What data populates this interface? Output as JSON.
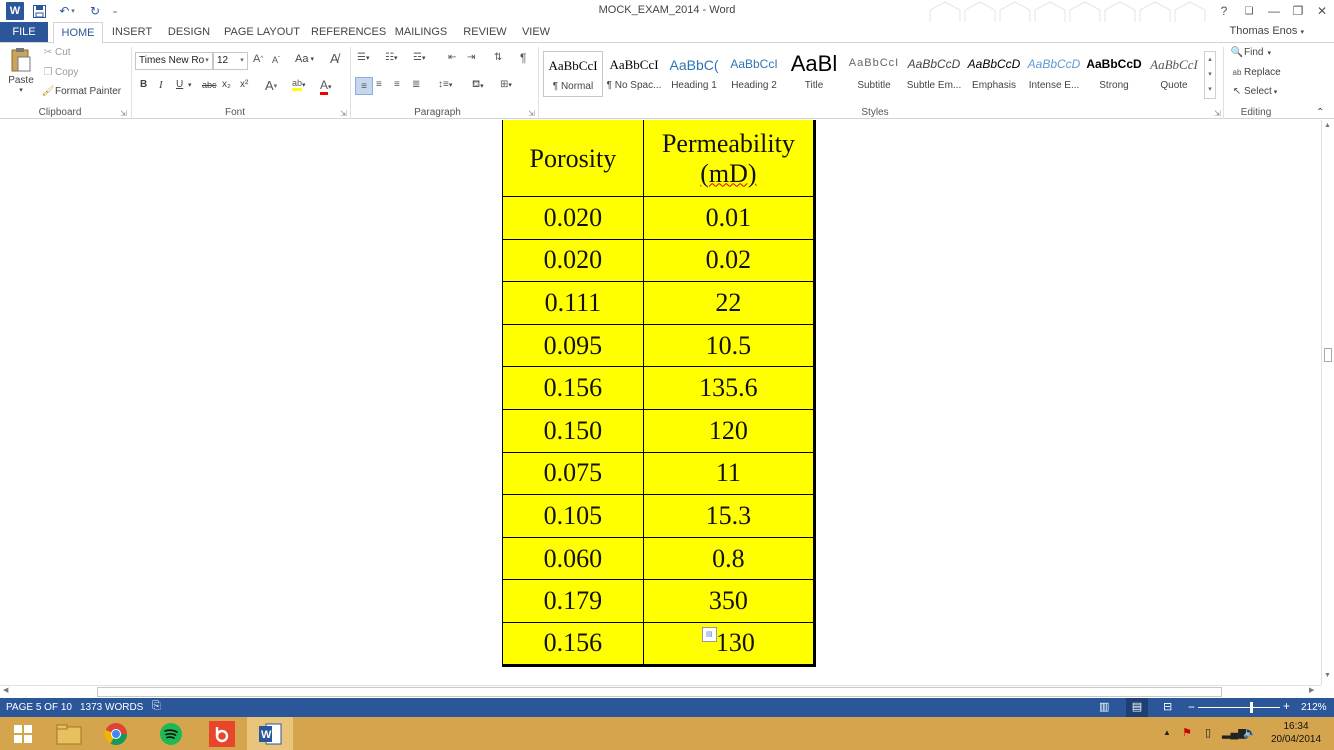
{
  "window": {
    "title": "MOCK_EXAM_2014 - Word",
    "user": "Thomas Enos",
    "help": "?",
    "minimize": "—",
    "restore": "❐",
    "close": "✕",
    "ribbon_toggle": "❏"
  },
  "tabs": [
    "FILE",
    "HOME",
    "INSERT",
    "DESIGN",
    "PAGE LAYOUT",
    "REFERENCES",
    "MAILINGS",
    "REVIEW",
    "VIEW"
  ],
  "clipboard": {
    "paste": "Paste",
    "cut": "Cut",
    "copy": "Copy",
    "format_painter": "Format Painter",
    "label": "Clipboard"
  },
  "font": {
    "name": "Times New Ro",
    "size": "12",
    "label": "Font",
    "change_case": "Aa",
    "bold": "B",
    "italic": "I",
    "underline": "U",
    "strike": "abc",
    "subscript": "x₂",
    "superscript": "x²"
  },
  "paragraph": {
    "label": "Paragraph"
  },
  "styles": {
    "label": "Styles",
    "items": [
      {
        "preview": "AaBbCcI",
        "name": "¶ Normal"
      },
      {
        "preview": "AaBbCcI",
        "name": "¶ No Spac..."
      },
      {
        "preview": "AaBbC(",
        "name": "Heading 1"
      },
      {
        "preview": "AaBbCcI",
        "name": "Heading 2"
      },
      {
        "preview": "AaBl",
        "name": "Title"
      },
      {
        "preview": "AaBbCcI",
        "name": "Subtitle"
      },
      {
        "preview": "AaBbCcD",
        "name": "Subtle Em..."
      },
      {
        "preview": "AaBbCcD",
        "name": "Emphasis"
      },
      {
        "preview": "AaBbCcD",
        "name": "Intense E..."
      },
      {
        "preview": "AaBbCcD",
        "name": "Strong"
      },
      {
        "preview": "AaBbCcI",
        "name": "Quote"
      }
    ]
  },
  "editing": {
    "find": "Find",
    "replace": "Replace",
    "select": "Select",
    "label": "Editing"
  },
  "table": {
    "headers": [
      "Porosity",
      "Permeability",
      "(mD)"
    ],
    "rows": [
      [
        "0.020",
        "0.01"
      ],
      [
        "0.020",
        "0.02"
      ],
      [
        "0.111",
        "22"
      ],
      [
        "0.095",
        "10.5"
      ],
      [
        "0.156",
        "135.6"
      ],
      [
        "0.150",
        "120"
      ],
      [
        "0.075",
        "11"
      ],
      [
        "0.105",
        "15.3"
      ],
      [
        "0.060",
        "0.8"
      ],
      [
        "0.179",
        "350"
      ],
      [
        "0.156",
        "130"
      ]
    ]
  },
  "status": {
    "page": "PAGE 5 OF 10",
    "words": "1373 WORDS",
    "zoom": "212%"
  },
  "taskbar": {
    "time": "16:34",
    "date": "20/04/2014"
  },
  "colors": {
    "accent": "#2b579a",
    "table_fill": "#ffff00",
    "taskbar": "#d5a54e"
  }
}
